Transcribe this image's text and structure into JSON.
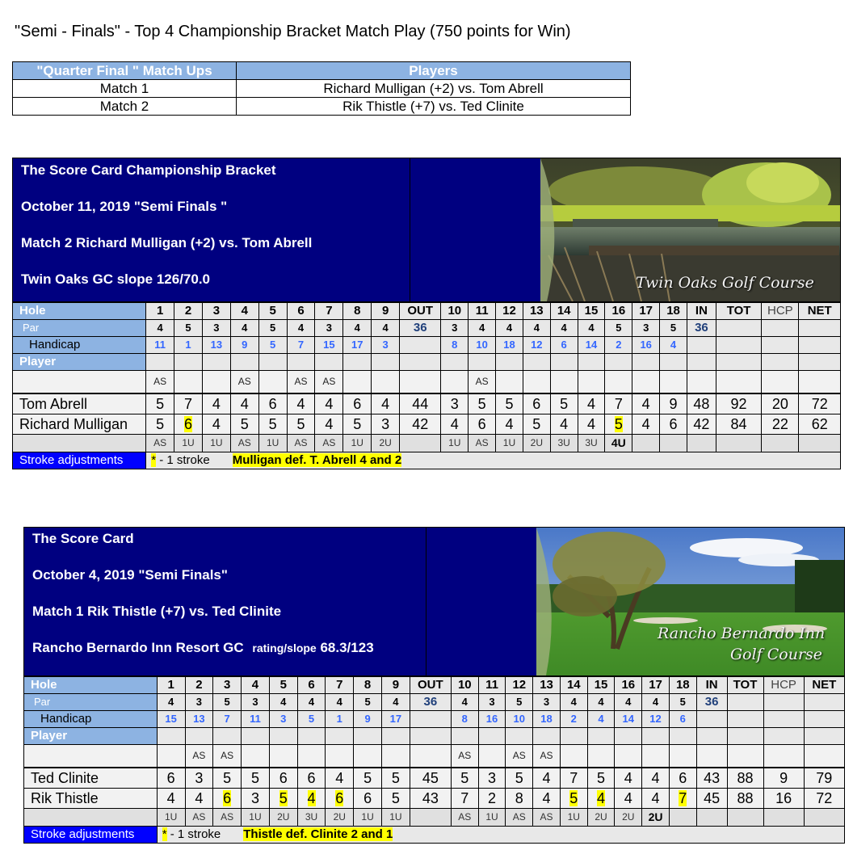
{
  "page_title": "\"Semi - Finals\" - Top 4 Championship Bracket Match Play (750 points for Win)",
  "matchups": {
    "headers": [
      "\"Quarter Final \" Match Ups",
      "Players"
    ],
    "rows": [
      {
        "match": "Match 1",
        "players": "Richard Mulligan (+2) vs. Tom Abrell"
      },
      {
        "match": "Match 2",
        "players": "Rik Thistle (+7) vs. Ted Clinite"
      }
    ]
  },
  "labels": {
    "hole": "Hole",
    "par": "Par",
    "handicap": "Handicap",
    "player": "Player",
    "stroke_adjustments": "Stroke  adjustments",
    "stroke_note_mark": "*",
    "stroke_note": " - 1 stroke",
    "out": "OUT",
    "in": "IN",
    "tot": "TOT",
    "hcp": "HCP",
    "net": "NET"
  },
  "cards": [
    {
      "header_lines": [
        "The Score Card    Championship Bracket",
        "October 11, 2019   \"Semi Finals \"",
        "Match 2    Richard Mulligan (+2) vs. Tom Abrell",
        "Twin Oaks  GC   slope 126/70.0"
      ],
      "photo_caption": "Twin Oaks Golf Course",
      "holes": [
        "1",
        "2",
        "3",
        "4",
        "5",
        "6",
        "7",
        "8",
        "9",
        "10",
        "11",
        "12",
        "13",
        "14",
        "15",
        "16",
        "17",
        "18"
      ],
      "par": [
        "4",
        "5",
        "3",
        "4",
        "5",
        "4",
        "3",
        "4",
        "4",
        "3",
        "4",
        "4",
        "4",
        "4",
        "4",
        "5",
        "3",
        "5"
      ],
      "par_out": "36",
      "par_in": "36",
      "handicap": [
        "11",
        "1",
        "13",
        "9",
        "5",
        "7",
        "15",
        "17",
        "3",
        "8",
        "10",
        "18",
        "12",
        "6",
        "14",
        "2",
        "16",
        "4"
      ],
      "status_top": [
        "AS",
        "",
        "",
        "AS",
        "",
        "AS",
        "AS",
        "",
        "",
        "",
        "AS",
        "",
        "",
        "",
        "",
        "",
        "",
        ""
      ],
      "players": [
        {
          "name": "Tom Abrell",
          "scores": [
            "5",
            "7",
            "4",
            "4",
            "6",
            "4",
            "4",
            "6",
            "4",
            "3",
            "5",
            "5",
            "6",
            "5",
            "4",
            "7",
            "4",
            "9"
          ],
          "out": "44",
          "in": "48",
          "tot": "92",
          "hcp": "20",
          "net": "72",
          "stroke_holes": []
        },
        {
          "name": "Richard Mulligan",
          "scores": [
            "5",
            "6",
            "4",
            "5",
            "5",
            "5",
            "4",
            "5",
            "3",
            "4",
            "6",
            "4",
            "5",
            "4",
            "4",
            "5",
            "4",
            "6"
          ],
          "out": "42",
          "in": "42",
          "tot": "84",
          "hcp": "22",
          "net": "62",
          "stroke_holes": [
            2,
            16
          ]
        }
      ],
      "status_bottom": [
        "AS",
        "1U",
        "1U",
        "AS",
        "1U",
        "AS",
        "AS",
        "1U",
        "2U",
        "1U",
        "AS",
        "1U",
        "2U",
        "3U",
        "3U",
        "4U",
        "",
        ""
      ],
      "final_hole": 16,
      "result": "Mulligan def. T. Abrell 4 and 2"
    },
    {
      "header_lines": [
        "The Score Card",
        "October 4, 2019    \"Semi Finals\"",
        "Match 1        Rik Thistle (+7) vs. Ted Clinite",
        "Rancho Bernardo Inn Resort GC"
      ],
      "header_rating_label": "rating/slope",
      "header_rating_value": "68.3/123",
      "photo_caption": "Rancho Bernardo Inn",
      "photo_caption2": "Golf Course",
      "holes": [
        "1",
        "2",
        "3",
        "4",
        "5",
        "6",
        "7",
        "8",
        "9",
        "10",
        "11",
        "12",
        "13",
        "14",
        "15",
        "16",
        "17",
        "18"
      ],
      "par": [
        "4",
        "3",
        "5",
        "3",
        "4",
        "4",
        "4",
        "5",
        "4",
        "4",
        "3",
        "5",
        "3",
        "4",
        "4",
        "4",
        "4",
        "5"
      ],
      "par_out": "36",
      "par_in": "36",
      "handicap": [
        "15",
        "13",
        "7",
        "11",
        "3",
        "5",
        "1",
        "9",
        "17",
        "8",
        "16",
        "10",
        "18",
        "2",
        "4",
        "14",
        "12",
        "6"
      ],
      "status_top": [
        "",
        "AS",
        "AS",
        "",
        "",
        "",
        "",
        "",
        "",
        "AS",
        "",
        "AS",
        "AS",
        "",
        "",
        "",
        "",
        ""
      ],
      "players": [
        {
          "name": "Ted Clinite",
          "scores": [
            "6",
            "3",
            "5",
            "5",
            "6",
            "6",
            "4",
            "5",
            "5",
            "5",
            "3",
            "5",
            "4",
            "7",
            "5",
            "4",
            "4",
            "6"
          ],
          "out": "45",
          "in": "43",
          "tot": "88",
          "hcp": "9",
          "net": "79",
          "stroke_holes": []
        },
        {
          "name": "Rik Thistle",
          "scores": [
            "4",
            "4",
            "6",
            "3",
            "5",
            "4",
            "6",
            "6",
            "5",
            "7",
            "2",
            "8",
            "4",
            "5",
            "4",
            "4",
            "4",
            "7"
          ],
          "out": "43",
          "in": "45",
          "tot": "88",
          "hcp": "16",
          "net": "72",
          "stroke_holes": [
            3,
            5,
            6,
            7,
            14,
            15,
            18
          ]
        }
      ],
      "status_bottom": [
        "1U",
        "AS",
        "AS",
        "1U",
        "2U",
        "3U",
        "2U",
        "1U",
        "1U",
        "AS",
        "1U",
        "AS",
        "AS",
        "1U",
        "2U",
        "2U",
        "2U",
        ""
      ],
      "final_hole": 17,
      "result": "Thistle def. Clinite 2 and 1"
    }
  ]
}
